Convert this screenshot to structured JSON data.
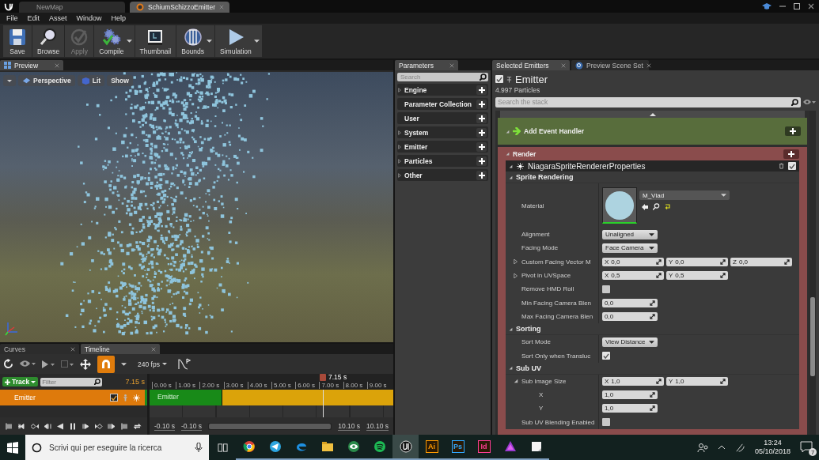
{
  "app_tabs": [
    {
      "label": "NewMap",
      "selected": false
    },
    {
      "label": "SchiumSchizzoEmitter",
      "selected": true
    }
  ],
  "menu": [
    "File",
    "Edit",
    "Asset",
    "Window",
    "Help"
  ],
  "toolbar": [
    {
      "label": "Save",
      "disabled": false,
      "dropdown": false
    },
    {
      "label": "Browse",
      "disabled": false,
      "dropdown": false
    },
    {
      "label": "Apply",
      "disabled": true,
      "dropdown": false
    },
    {
      "label": "Compile",
      "disabled": false,
      "dropdown": true
    },
    {
      "label": "Thumbnail",
      "disabled": false,
      "dropdown": false
    },
    {
      "label": "Bounds",
      "disabled": false,
      "dropdown": true
    },
    {
      "label": "Simulation",
      "disabled": false,
      "dropdown": true
    }
  ],
  "preview": {
    "tab": "Preview",
    "view_buttons": [
      "Perspective",
      "Lit",
      "Show"
    ]
  },
  "parameters": {
    "tab": "Parameters",
    "search": {
      "placeholder": "Search"
    },
    "categories": [
      {
        "label": "Engine",
        "expandable": true
      },
      {
        "label": "Parameter Collection",
        "expandable": false
      },
      {
        "label": "User",
        "expandable": false
      },
      {
        "label": "System",
        "expandable": true
      },
      {
        "label": "Emitter",
        "expandable": true
      },
      {
        "label": "Particles",
        "expandable": true
      },
      {
        "label": "Other",
        "expandable": true
      }
    ]
  },
  "details": {
    "tabs": [
      {
        "label": "Selected Emitters",
        "selected": true
      },
      {
        "label": "Preview Scene Set",
        "selected": false
      }
    ],
    "emitter": {
      "name": "Emitter",
      "enabled": true
    },
    "particles": "4.997 Particles",
    "search": {
      "placeholder": "Search the stack"
    },
    "event_handler": "Add Event Handler",
    "render": {
      "label": "Render",
      "renderer": {
        "label": "NiagaraSpriteRendererProperties",
        "enabled": true
      },
      "groups": [
        {
          "label": "Sprite Rendering",
          "expanded": true,
          "rows": [
            {
              "kind": "material",
              "label": "Material",
              "value": "M_Vlad"
            },
            {
              "kind": "dropdown",
              "label": "Alignment",
              "value": "Unaligned"
            },
            {
              "kind": "dropdown",
              "label": "Facing Mode",
              "value": "Face Camera"
            },
            {
              "kind": "vector",
              "label": "Custom Facing Vector M",
              "expanded": false,
              "components": [
                {
                  "axis": "X",
                  "value": "0,0"
                },
                {
                  "axis": "Y",
                  "value": "0,0"
                },
                {
                  "axis": "Z",
                  "value": "0,0"
                }
              ]
            },
            {
              "kind": "vector",
              "label": "Pivot in UVSpace",
              "expanded": false,
              "components": [
                {
                  "axis": "X",
                  "value": "0,5"
                },
                {
                  "axis": "Y",
                  "value": "0,5"
                }
              ]
            },
            {
              "kind": "checkbox",
              "label": "Remove HMD Roll",
              "checked": false
            },
            {
              "kind": "number",
              "label": "Min Facing Camera Blen",
              "value": "0,0"
            },
            {
              "kind": "number",
              "label": "Max Facing Camera Blen",
              "value": "0,0"
            }
          ]
        },
        {
          "label": "Sorting",
          "expanded": true,
          "rows": [
            {
              "kind": "dropdown",
              "label": "Sort Mode",
              "value": "View Distance"
            },
            {
              "kind": "checkbox",
              "label": "Sort Only when Transluc",
              "checked": true
            }
          ]
        },
        {
          "label": "Sub UV",
          "expanded": true,
          "rows": [
            {
              "kind": "vector",
              "label": "Sub Image Size",
              "expanded": true,
              "components": [
                {
                  "axis": "X",
                  "value": "1,0"
                },
                {
                  "axis": "Y",
                  "value": "1,0"
                }
              ],
              "children": [
                {
                  "kind": "number",
                  "label": "X",
                  "value": "1,0"
                },
                {
                  "kind": "number",
                  "label": "Y",
                  "value": "1,0"
                }
              ]
            },
            {
              "kind": "checkbox",
              "label": "Sub UV Blending Enabled",
              "checked": false
            }
          ]
        }
      ]
    }
  },
  "timeline": {
    "tabs": [
      {
        "label": "Curves",
        "selected": false
      },
      {
        "label": "Timeline",
        "selected": true
      }
    ],
    "snap_on": true,
    "fps": "240 fps",
    "add_track": "Track",
    "filter": {
      "placeholder": "Filter"
    },
    "current_time": "7.15 s",
    "tracks": [
      {
        "label": "Emitter",
        "enabled": true,
        "selected": true
      }
    ],
    "ruler": [
      "0.00 s",
      "1.00 s",
      "2.00 s",
      "3.00 s",
      "4.00 s",
      "5.00 s",
      "6.00 s",
      "7.00 s",
      "8.00 s",
      "9.00 s"
    ],
    "playhead": {
      "label": "7.15 s",
      "level": 0.711
    },
    "sections": [
      {
        "label": "Emitter",
        "level": 0.299
      }
    ],
    "range": [
      "-0.10 s",
      "-0.10 s",
      "10.10 s",
      "10.10 s"
    ]
  },
  "taskbar": {
    "search": {
      "placeholder": "Scrivi qui per eseguire la ricerca"
    },
    "apps": [
      {
        "selected": false
      },
      {
        "selected": false
      },
      {
        "selected": false
      },
      {
        "selected": false
      },
      {
        "selected": false
      },
      {
        "selected": false
      },
      {
        "selected": true
      },
      {
        "selected": false,
        "text": "Ai"
      },
      {
        "selected": false,
        "text": "Ps"
      },
      {
        "selected": false,
        "text": "Id"
      },
      {
        "selected": false
      },
      {
        "selected": false
      }
    ],
    "time": "13:24",
    "date": "05/10/2018",
    "notifications": "7"
  }
}
